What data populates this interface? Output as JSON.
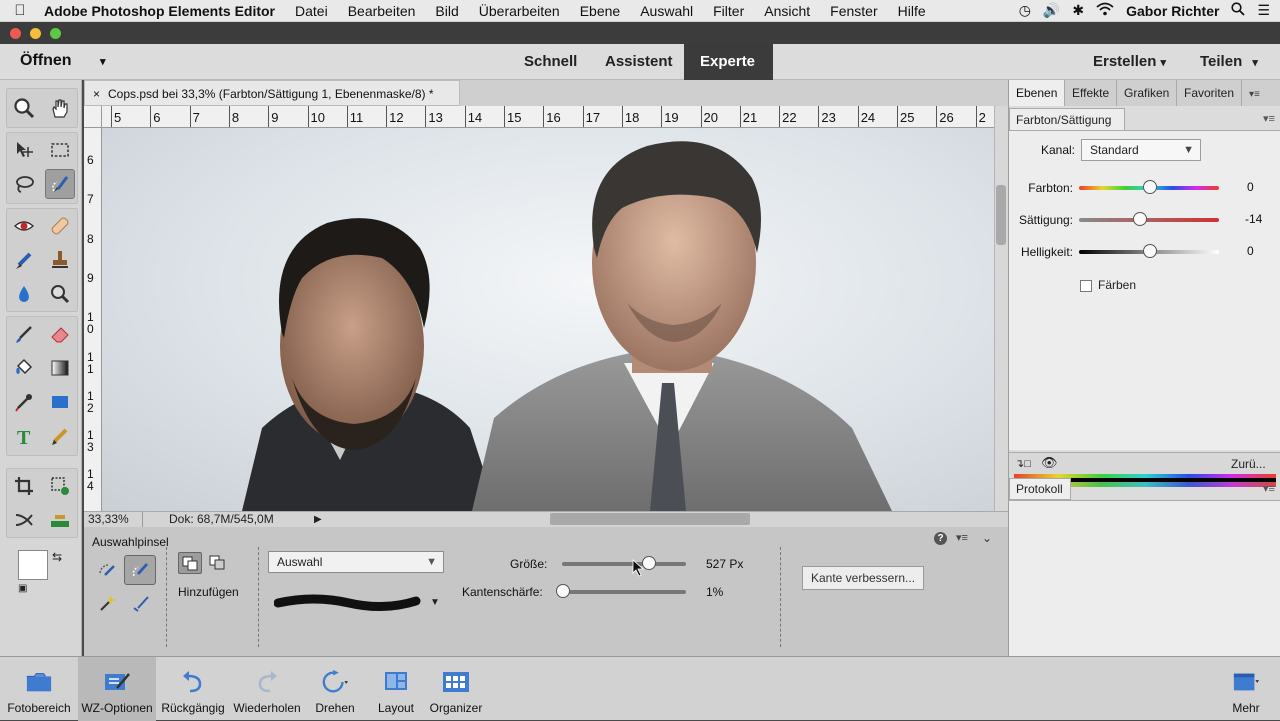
{
  "menubar": {
    "app": "Adobe Photoshop Elements Editor",
    "items": [
      "Datei",
      "Bearbeiten",
      "Bild",
      "Überarbeiten",
      "Ebene",
      "Auswahl",
      "Filter",
      "Ansicht",
      "Fenster",
      "Hilfe"
    ],
    "user": "Gabor Richter"
  },
  "modebar": {
    "open_label": "Öffnen",
    "modes": [
      "Schnell",
      "Assistent",
      "Experte"
    ],
    "active_mode": "Experte",
    "create_label": "Erstellen",
    "share_label": "Teilen"
  },
  "document": {
    "tab_title": "Cops.psd bei 33,3% (Farbton/Sättigung 1, Ebenenmaske/8) *",
    "close_glyph": "×"
  },
  "rulers": {
    "horizontal": [
      "5",
      "6",
      "7",
      "8",
      "9",
      "10",
      "11",
      "12",
      "13",
      "14",
      "15",
      "16",
      "17",
      "18",
      "19",
      "20",
      "21",
      "22",
      "23",
      "24",
      "25",
      "26",
      "2"
    ],
    "vertical": [
      "6",
      "7",
      "8",
      "9",
      "1 0",
      "1 1",
      "1 2",
      "1 3",
      "1 4"
    ]
  },
  "status": {
    "zoom": "33,33%",
    "doc_info": "Dok: 68,7M/545,0M"
  },
  "tool_options": {
    "tool_name": "Auswahlpinsel",
    "add_label": "Hinzufügen",
    "mode_value": "Auswahl",
    "size_label": "Größe:",
    "size_value": "527 Px",
    "size_fraction": 0.7,
    "hardness_label": "Kantenschärfe:",
    "hardness_value": "1%",
    "hardness_fraction": 0.01,
    "refine_label": "Kante verbessern..."
  },
  "bottombar": {
    "items": [
      "Fotobereich",
      "WZ-Optionen",
      "Rückgängig",
      "Wiederholen",
      "Drehen",
      "Layout",
      "Organizer"
    ],
    "more_label": "Mehr"
  },
  "panels": {
    "tabs": [
      "Ebenen",
      "Effekte",
      "Grafiken",
      "Favoriten"
    ],
    "active_tab": "Ebenen",
    "adjustment_tab": "Farbton/Sättigung",
    "channel_label": "Kanal:",
    "channel_value": "Standard",
    "hue_label": "Farbton:",
    "hue_value": "0",
    "saturation_label": "Sättigung:",
    "saturation_value": "-14",
    "lightness_label": "Helligkeit:",
    "lightness_value": "0",
    "colorize_label": "Färben",
    "colorize_checked": false,
    "reset_label": "Zurü...",
    "history_tab": "Protokoll"
  },
  "colors": {
    "active_mode_bg": "#3b3b3b",
    "canvas_bg": "#e2e7eb"
  }
}
